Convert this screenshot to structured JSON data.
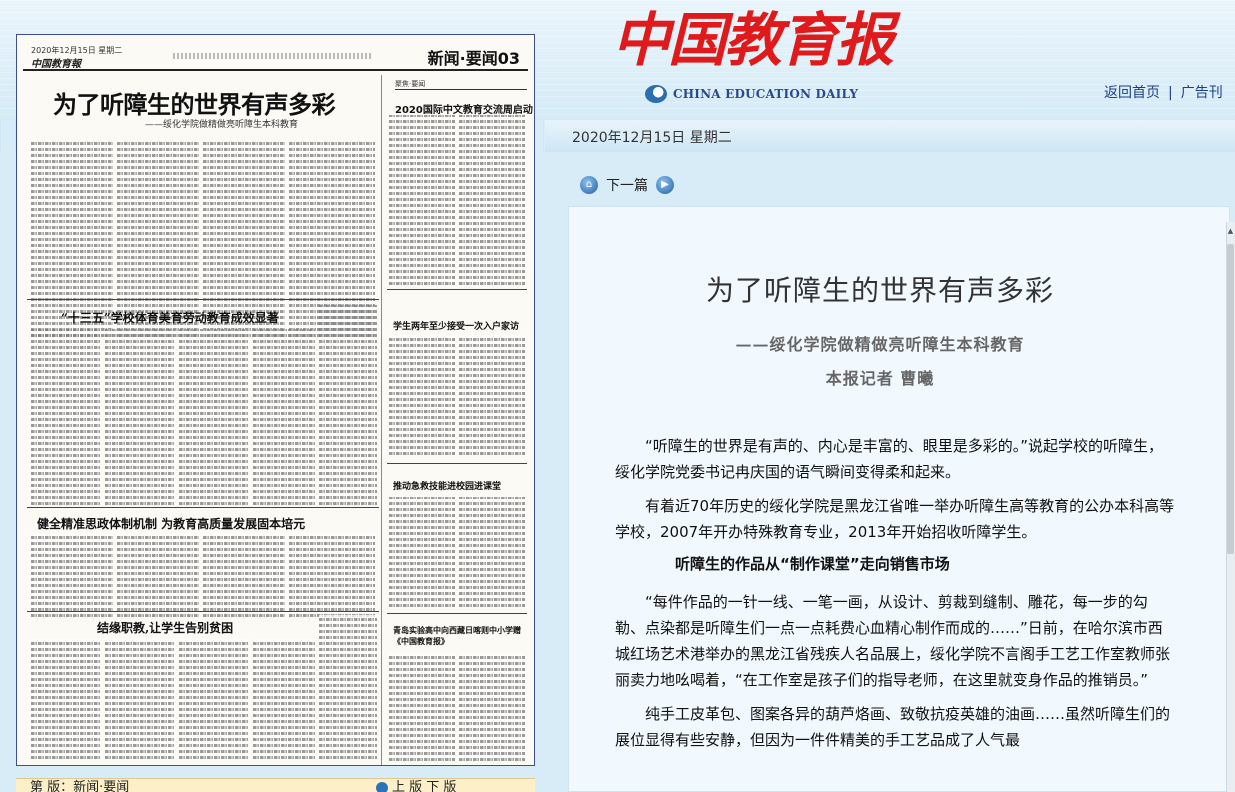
{
  "header": {
    "logo_cn": "中国教育报",
    "logo_en": "CHINA EDUCATION DAILY",
    "links": [
      "返回首页",
      "广告刊"
    ]
  },
  "date": "2020年12月15日  星期二",
  "nav": {
    "next_label": "下一篇"
  },
  "paper": {
    "masthead": "中国教育報",
    "date_small": "2020年12月15日 星期二",
    "section": "新闻·要闻03",
    "title": "为了听障生的世界有声多彩",
    "subtitle": "——绥化学院做精做亮听障生本科教育",
    "side_tag": "聚焦·要闻",
    "side_title": "2020国际中文教育交流周启动",
    "headline2": "“十三五”学校体育美育劳动教育成效显著",
    "headline3": "学生两年至少接受一次入户家访",
    "headline4": "健全精准思政体制机制  为教育高质量发展固本培元",
    "headline5": "推动急救技能进校园进课堂",
    "headline6": "结缘职教,让学生告别贫困",
    "headline7": "青岛实验高中向西藏日喀则中小学赠《中国教育报》",
    "bottom_left": "第 版：新闻·要闻",
    "bottom_right": "上 版  下 版"
  },
  "article": {
    "title": "为了听障生的世界有声多彩",
    "subtitle": "——绥化学院做精做亮听障生本科教育",
    "byline": "本报记者  曹曦",
    "paragraphs": [
      "“听障生的世界是有声的、内心是丰富的、眼里是多彩的。”说起学校的听障生，绥化学院党委书记冉庆国的语气瞬间变得柔和起来。",
      "有着近70年历史的绥化学院是黑龙江省唯一举办听障生高等教育的公办本科高等学校，2007年开办特殊教育专业，2013年开始招收听障学生。"
    ],
    "heading1": "听障生的作品从“制作课堂”走向销售市场",
    "paragraphs2": [
      "“每件作品的一针一线、一笔一画，从设计、剪裁到缝制、雕花，每一步的勾勒、点染都是听障生们一点一点耗费心血精心制作而成的……”日前，在哈尔滨市西城红场艺术港举办的黑龙江省残疾人名品展上，绥化学院不言阁手工艺工作室教师张丽卖力地吆喝着，“在工作室是孩子们的指导老师，在这里就变身作品的推销员。”",
      "纯手工皮革包、图案各异的葫芦烙画、致敬抗疫英雄的油画……虽然听障生们的展位显得有些安静，但因为一件件精美的手工艺品成了人气最"
    ]
  },
  "colors": {
    "logo_red": "#e01a1a",
    "link_blue": "#1d3f8a",
    "panel_border": "#3d4f8c"
  }
}
